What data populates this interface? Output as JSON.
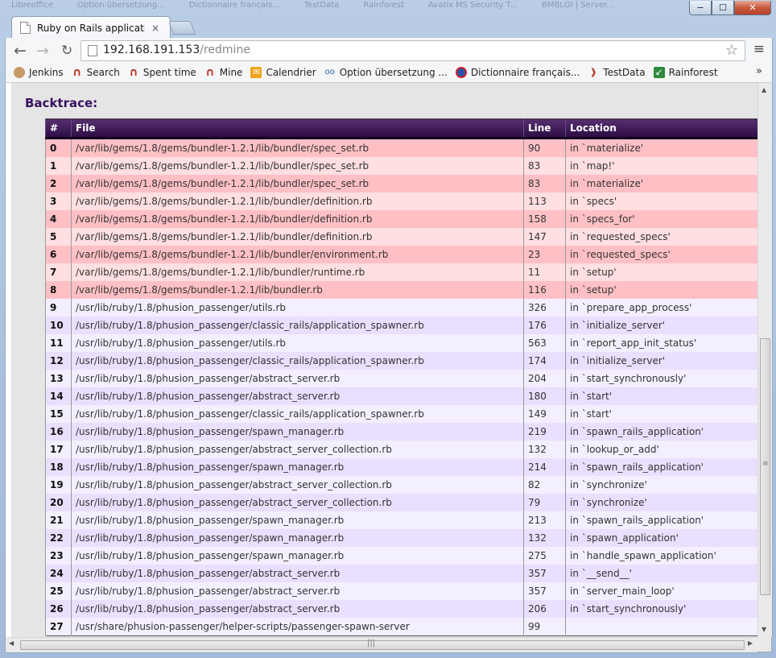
{
  "background_tabs": [
    "Libreoffice",
    "Option übersetzung...",
    "Dictionnaire français...",
    "TestData",
    "Rainforest",
    "Avatix MS Security T...",
    "BMBLGI | Server..."
  ],
  "window_controls": {
    "minimize": "−",
    "maximize": "☐",
    "close": "✕"
  },
  "tab": {
    "title": "Ruby on Rails application",
    "close": "×"
  },
  "toolbar": {
    "url_host": "192.168.191.153",
    "url_path": "/redmine",
    "back": "←",
    "forward": "→",
    "reload": "↻",
    "star": "☆",
    "menu": "≡"
  },
  "bookmarks": [
    {
      "label": "Jenkins",
      "icon": "jenkins-icon"
    },
    {
      "label": "Search",
      "icon": "redmine-icon"
    },
    {
      "label": "Spent time",
      "icon": "redmine-icon"
    },
    {
      "label": "Mine",
      "icon": "redmine-icon"
    },
    {
      "label": "Calendrier",
      "icon": "calendar-icon"
    },
    {
      "label": "Option übersetzung ...",
      "icon": "translation-icon"
    },
    {
      "label": "Dictionnaire français...",
      "icon": "dictionary-icon"
    },
    {
      "label": "TestData",
      "icon": "testdata-icon"
    },
    {
      "label": "Rainforest",
      "icon": "rainforest-icon"
    }
  ],
  "bookmarks_more": "»",
  "page": {
    "heading": "Backtrace:",
    "columns": [
      "#",
      "File",
      "Line",
      "Location"
    ],
    "gem_row_colors": [
      "#ffc0c5",
      "#ffdfe1"
    ],
    "system_row_colors": [
      "#f3efff",
      "#eadfff"
    ],
    "rows": [
      {
        "num": "0",
        "file": "/var/lib/gems/1.8/gems/bundler-1.2.1/lib/bundler/spec_set.rb",
        "line": "90",
        "location": "in `materialize'",
        "type": "gem"
      },
      {
        "num": "1",
        "file": "/var/lib/gems/1.8/gems/bundler-1.2.1/lib/bundler/spec_set.rb",
        "line": "83",
        "location": "in `map!'",
        "type": "gem"
      },
      {
        "num": "2",
        "file": "/var/lib/gems/1.8/gems/bundler-1.2.1/lib/bundler/spec_set.rb",
        "line": "83",
        "location": "in `materialize'",
        "type": "gem"
      },
      {
        "num": "3",
        "file": "/var/lib/gems/1.8/gems/bundler-1.2.1/lib/bundler/definition.rb",
        "line": "113",
        "location": "in `specs'",
        "type": "gem"
      },
      {
        "num": "4",
        "file": "/var/lib/gems/1.8/gems/bundler-1.2.1/lib/bundler/definition.rb",
        "line": "158",
        "location": "in `specs_for'",
        "type": "gem"
      },
      {
        "num": "5",
        "file": "/var/lib/gems/1.8/gems/bundler-1.2.1/lib/bundler/definition.rb",
        "line": "147",
        "location": "in `requested_specs'",
        "type": "gem"
      },
      {
        "num": "6",
        "file": "/var/lib/gems/1.8/gems/bundler-1.2.1/lib/bundler/environment.rb",
        "line": "23",
        "location": "in `requested_specs'",
        "type": "gem"
      },
      {
        "num": "7",
        "file": "/var/lib/gems/1.8/gems/bundler-1.2.1/lib/bundler/runtime.rb",
        "line": "11",
        "location": "in `setup'",
        "type": "gem"
      },
      {
        "num": "8",
        "file": "/var/lib/gems/1.8/gems/bundler-1.2.1/lib/bundler.rb",
        "line": "116",
        "location": "in `setup'",
        "type": "gem"
      },
      {
        "num": "9",
        "file": "/usr/lib/ruby/1.8/phusion_passenger/utils.rb",
        "line": "326",
        "location": "in `prepare_app_process'",
        "type": "system"
      },
      {
        "num": "10",
        "file": "/usr/lib/ruby/1.8/phusion_passenger/classic_rails/application_spawner.rb",
        "line": "176",
        "location": "in `initialize_server'",
        "type": "system"
      },
      {
        "num": "11",
        "file": "/usr/lib/ruby/1.8/phusion_passenger/utils.rb",
        "line": "563",
        "location": "in `report_app_init_status'",
        "type": "system"
      },
      {
        "num": "12",
        "file": "/usr/lib/ruby/1.8/phusion_passenger/classic_rails/application_spawner.rb",
        "line": "174",
        "location": "in `initialize_server'",
        "type": "system"
      },
      {
        "num": "13",
        "file": "/usr/lib/ruby/1.8/phusion_passenger/abstract_server.rb",
        "line": "204",
        "location": "in `start_synchronously'",
        "type": "system"
      },
      {
        "num": "14",
        "file": "/usr/lib/ruby/1.8/phusion_passenger/abstract_server.rb",
        "line": "180",
        "location": "in `start'",
        "type": "system"
      },
      {
        "num": "15",
        "file": "/usr/lib/ruby/1.8/phusion_passenger/classic_rails/application_spawner.rb",
        "line": "149",
        "location": "in `start'",
        "type": "system"
      },
      {
        "num": "16",
        "file": "/usr/lib/ruby/1.8/phusion_passenger/spawn_manager.rb",
        "line": "219",
        "location": "in `spawn_rails_application'",
        "type": "system"
      },
      {
        "num": "17",
        "file": "/usr/lib/ruby/1.8/phusion_passenger/abstract_server_collection.rb",
        "line": "132",
        "location": "in `lookup_or_add'",
        "type": "system"
      },
      {
        "num": "18",
        "file": "/usr/lib/ruby/1.8/phusion_passenger/spawn_manager.rb",
        "line": "214",
        "location": "in `spawn_rails_application'",
        "type": "system"
      },
      {
        "num": "19",
        "file": "/usr/lib/ruby/1.8/phusion_passenger/abstract_server_collection.rb",
        "line": "82",
        "location": "in `synchronize'",
        "type": "system"
      },
      {
        "num": "20",
        "file": "/usr/lib/ruby/1.8/phusion_passenger/abstract_server_collection.rb",
        "line": "79",
        "location": "in `synchronize'",
        "type": "system"
      },
      {
        "num": "21",
        "file": "/usr/lib/ruby/1.8/phusion_passenger/spawn_manager.rb",
        "line": "213",
        "location": "in `spawn_rails_application'",
        "type": "system"
      },
      {
        "num": "22",
        "file": "/usr/lib/ruby/1.8/phusion_passenger/spawn_manager.rb",
        "line": "132",
        "location": "in `spawn_application'",
        "type": "system"
      },
      {
        "num": "23",
        "file": "/usr/lib/ruby/1.8/phusion_passenger/spawn_manager.rb",
        "line": "275",
        "location": "in `handle_spawn_application'",
        "type": "system"
      },
      {
        "num": "24",
        "file": "/usr/lib/ruby/1.8/phusion_passenger/abstract_server.rb",
        "line": "357",
        "location": "in `__send__'",
        "type": "system"
      },
      {
        "num": "25",
        "file": "/usr/lib/ruby/1.8/phusion_passenger/abstract_server.rb",
        "line": "357",
        "location": "in `server_main_loop'",
        "type": "system"
      },
      {
        "num": "26",
        "file": "/usr/lib/ruby/1.8/phusion_passenger/abstract_server.rb",
        "line": "206",
        "location": "in `start_synchronously'",
        "type": "system"
      },
      {
        "num": "27",
        "file": "/usr/share/phusion-passenger/helper-scripts/passenger-spawn-server",
        "line": "99",
        "location": "",
        "type": "system"
      }
    ]
  },
  "scrollbars": {
    "up": "▲",
    "down": "▼",
    "left": "◀",
    "right": "▶",
    "grip_v": "≡",
    "grip_h": "|||"
  }
}
